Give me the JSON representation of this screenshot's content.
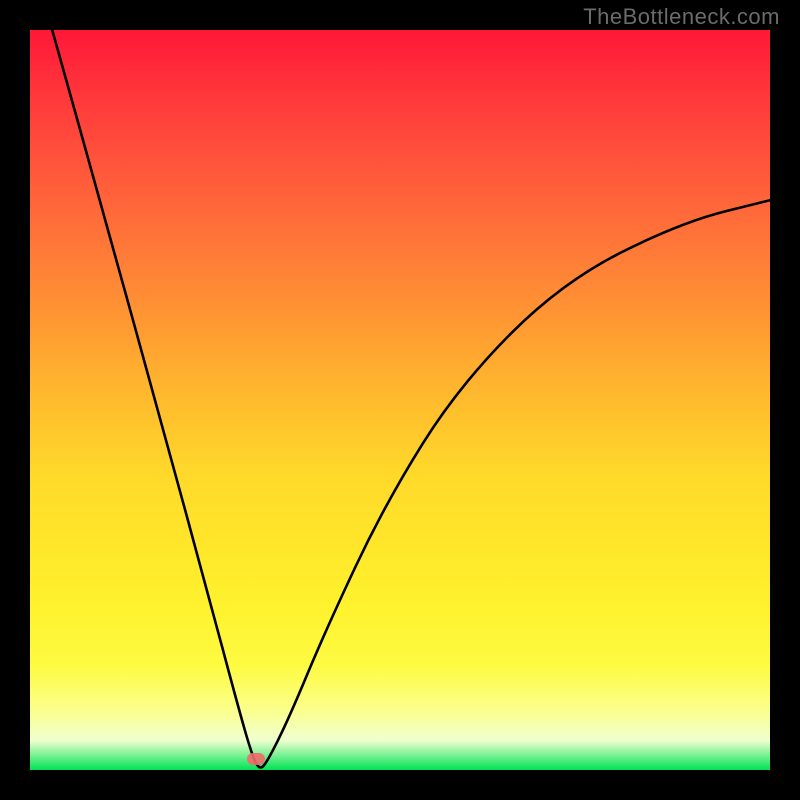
{
  "watermark": "TheBottleneck.com",
  "colors": {
    "curve": "#000000",
    "marker": "#f26a6a",
    "background_frame": "#000000"
  },
  "gradient_stops": [
    {
      "pos": 0.0,
      "color": "#ff1838"
    },
    {
      "pos": 0.5,
      "color": "#ffd92a"
    },
    {
      "pos": 0.92,
      "color": "#fbff8e"
    },
    {
      "pos": 1.0,
      "color": "#00e356"
    }
  ],
  "chart_data": {
    "type": "line",
    "title": "",
    "xlabel": "",
    "ylabel": "",
    "xlim": [
      0,
      100
    ],
    "ylim": [
      0,
      100
    ],
    "grid": false,
    "legend": false,
    "annotations": [
      {
        "type": "marker",
        "x": 30.5,
        "y": 1.5,
        "shape": "pill",
        "color": "#f26a6a"
      }
    ],
    "series": [
      {
        "name": "curve",
        "x": [
          3,
          10,
          18,
          24,
          28,
          30,
          31,
          32,
          35,
          40,
          48,
          58,
          72,
          88,
          100
        ],
        "y": [
          100,
          75,
          46,
          24,
          9,
          2,
          0,
          1,
          7,
          19,
          36,
          52,
          66,
          74,
          77
        ]
      }
    ],
    "vertex": {
      "x": 31,
      "y": 0
    }
  }
}
